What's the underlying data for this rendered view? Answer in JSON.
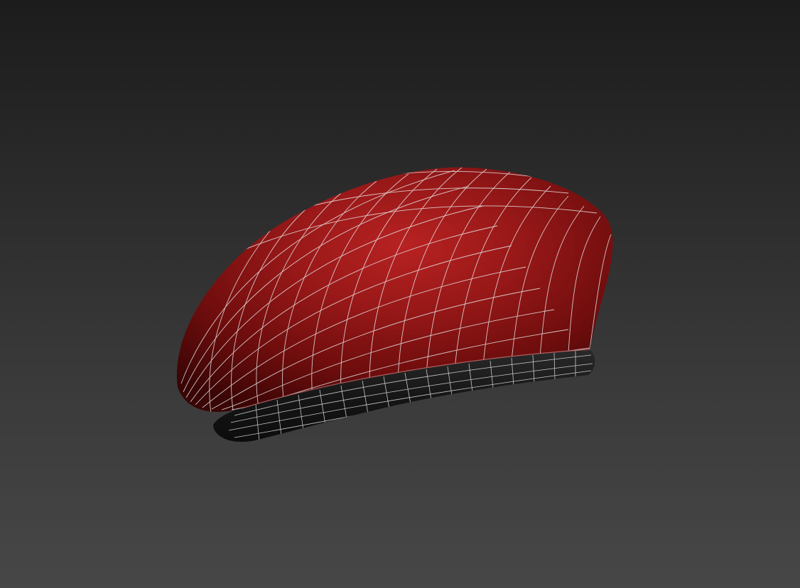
{
  "viewport": {
    "background_top": "#1c1c1c",
    "background_bottom": "#474747",
    "shading_mode": "smooth-edged-faces"
  },
  "model": {
    "object": "beret",
    "crown_color": "#8e1414",
    "crown_highlight": "#b82222",
    "crown_shadow": "#3a0505",
    "band_color": "#161616",
    "wireframe_color": "#e6e6e6"
  }
}
